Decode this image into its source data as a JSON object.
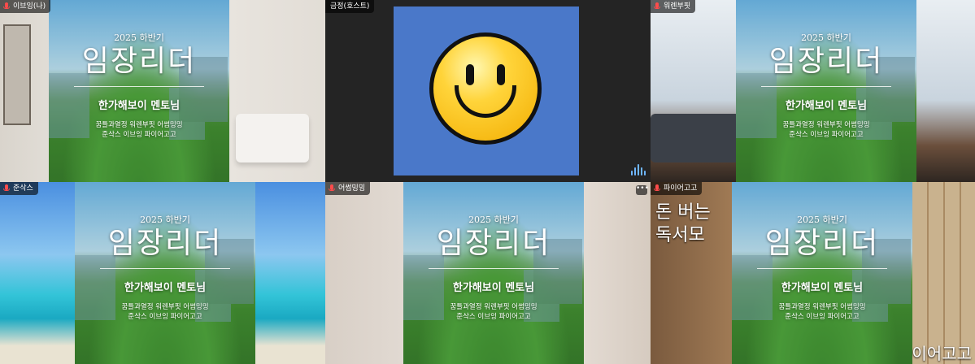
{
  "poster": {
    "year": "2025 하반기",
    "title": "임장리더",
    "subtitle": "한가해보이 멘토님",
    "names_line1": "꿈틀과열정  워렌부핏  어썸밍밍",
    "names_line2": "준삭스  이브잉  파이어고고"
  },
  "tiles": [
    {
      "name": "이브잉(나)"
    },
    {
      "name": "금정(호스트)"
    },
    {
      "name": "워렌부핏"
    },
    {
      "name": "준삭스"
    },
    {
      "name": "어썸밍밍"
    },
    {
      "name": "파이어고고"
    }
  ],
  "background_text": {
    "library_ad_line1": "돈 버는",
    "library_ad_line2": "독서모",
    "bottom_right": "이어고고"
  },
  "more_options_glyph": "•••",
  "colors": {
    "active_speaker": "#27c07a",
    "muted_mic": "#ff4b4b"
  }
}
